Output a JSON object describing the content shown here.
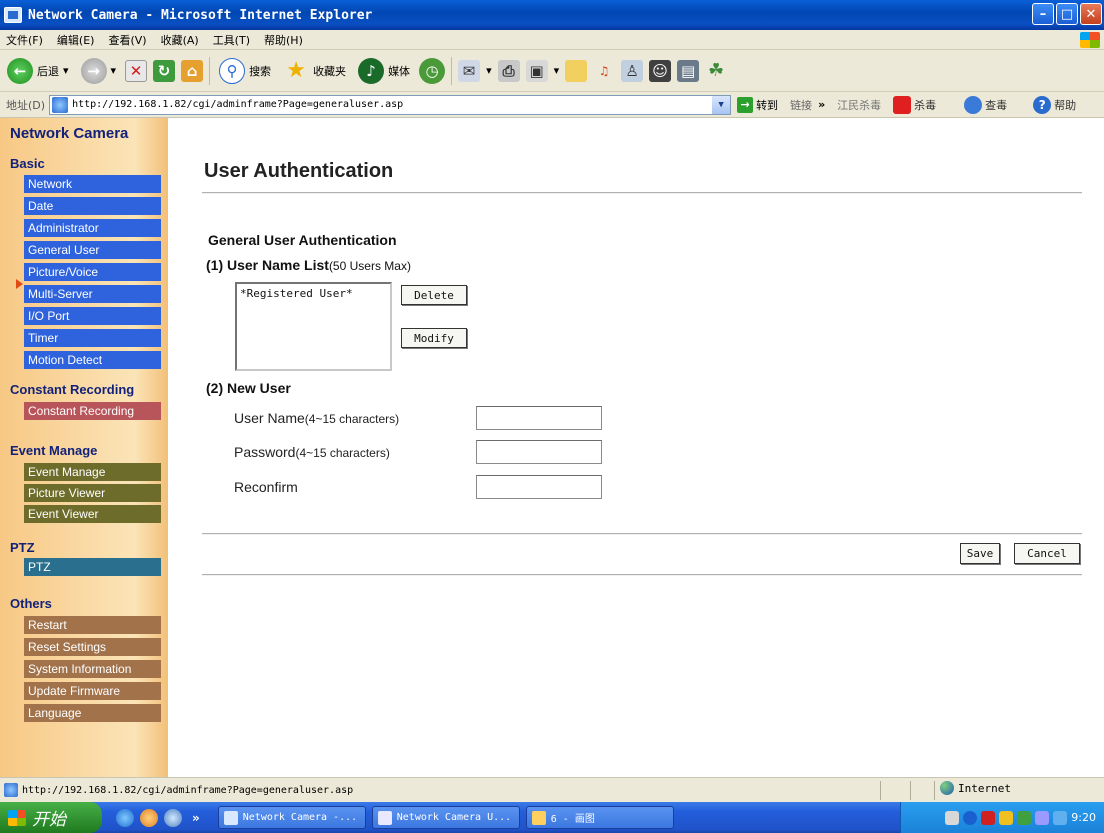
{
  "window": {
    "title": "Network Camera - Microsoft Internet Explorer",
    "colors": {
      "titlebar": "#0a4fc2",
      "sidebar": "#f7c884"
    }
  },
  "menu": [
    "文件(F)",
    "编辑(E)",
    "查看(V)",
    "收藏(A)",
    "工具(T)",
    "帮助(H)"
  ],
  "toolbar": {
    "back": "后退",
    "search": "搜索",
    "favorites": "收藏夹",
    "media": "媒体"
  },
  "address": {
    "label": "地址(D)",
    "url": "http://192.168.1.82/cgi/adminframe?Page=generaluser.asp",
    "go": "转到",
    "links": "链接",
    "more": "»",
    "item1": "江民杀毒",
    "item2": "杀毒",
    "item3": "查毒",
    "help": "帮助"
  },
  "sidebar": {
    "title": "Network Camera",
    "sections": [
      {
        "heading": "Basic",
        "color": "blue",
        "items": [
          "Network",
          "Date",
          "Administrator",
          "General User",
          "Picture/Voice",
          "Multi-Server",
          "I/O Port",
          "Timer",
          "Motion Detect"
        ]
      },
      {
        "heading": "Constant Recording",
        "color": "red",
        "items": [
          "Constant Recording"
        ]
      },
      {
        "heading": "Event Manage",
        "color": "olive",
        "items": [
          "Event Manage",
          "Picture Viewer",
          "Event Viewer"
        ]
      },
      {
        "heading": "PTZ",
        "color": "teal",
        "items": [
          "PTZ"
        ]
      },
      {
        "heading": "Others",
        "color": "brown",
        "items": [
          "Restart",
          "Reset Settings",
          "System Information",
          "Update Firmware",
          "Language"
        ]
      }
    ],
    "active": "General User"
  },
  "main": {
    "title": "User Authentication",
    "section_title": "General User Authentication",
    "list": {
      "label": "(1) User Name List",
      "note": "(50 Users Max)",
      "items": [
        "*Registered User*"
      ],
      "delete_label": "Delete",
      "modify_label": "Modify"
    },
    "new_user": {
      "label": "(2) New User",
      "username_label": "User Name",
      "username_note": "(4~15 characters)",
      "password_label": "Password",
      "password_note": "(4~15 characters)",
      "reconfirm_label": "Reconfirm",
      "username_value": "",
      "password_value": "",
      "reconfirm_value": ""
    },
    "save_label": "Save",
    "cancel_label": "Cancel"
  },
  "status": {
    "url": "http://192.168.1.82/cgi/adminframe?Page=generaluser.asp",
    "zone": "Internet"
  },
  "taskbar": {
    "start": "开始",
    "more": "»",
    "tasks": [
      "Network Camera -...",
      "Network Camera U...",
      "6 - 画图"
    ],
    "clock": "9:20"
  }
}
